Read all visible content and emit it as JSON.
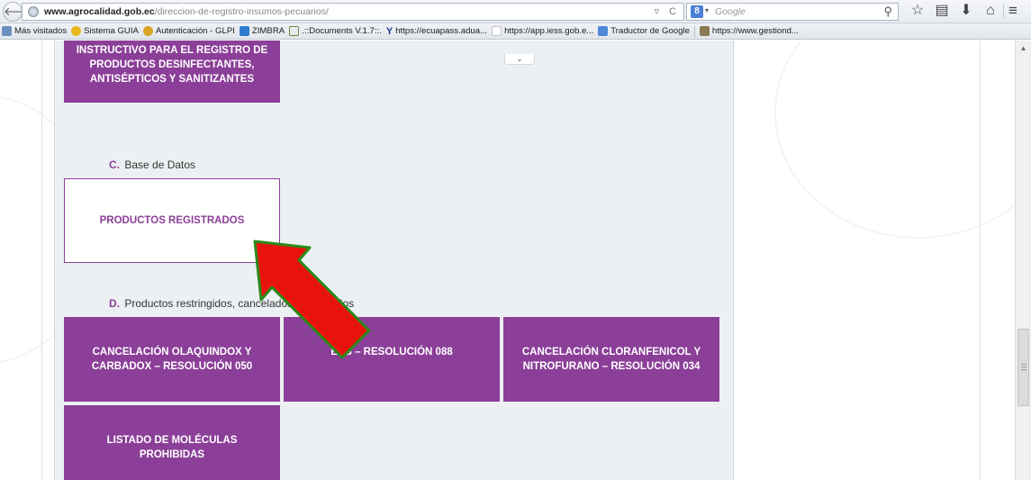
{
  "browser": {
    "url_domain": "www.agrocalidad.gob.ec",
    "url_path": "/direccion-de-registro-insumos-pecuarios/",
    "url_actions": "▿ C",
    "search_engine_letter": "8",
    "search_caret": "▾",
    "search_placeholder": "Google",
    "search_go": "⚲",
    "back_glyph": "🡐",
    "toolbar": [
      {
        "name": "bookmark-star-icon",
        "glyph": "☆"
      },
      {
        "name": "reading-list-icon",
        "glyph": "▤"
      },
      {
        "name": "download-icon",
        "glyph": "⬇"
      },
      {
        "name": "home-icon",
        "glyph": "⌂"
      }
    ],
    "menu_glyph": "≡"
  },
  "bookmarks": [
    {
      "label": "Más visitados",
      "icon": "folder"
    },
    {
      "label": "Sistema GUIA",
      "icon": "guia"
    },
    {
      "label": "Autenticación - GLPI",
      "icon": "glpi"
    },
    {
      "label": "ZIMBRA",
      "icon": "zimbra"
    },
    {
      "label": ".::Documents V.1.7::.",
      "icon": "doc"
    },
    {
      "label": "https://ecuapass.adua...",
      "icon": "v"
    },
    {
      "label": "https://app.iess.gob.e...",
      "icon": "blank"
    },
    {
      "label": "Traductor de Google",
      "icon": "tr"
    },
    {
      "label": "https://www.gestiond...",
      "icon": "gest"
    }
  ],
  "page": {
    "collapse_glyph": "⌄",
    "tile_instructivo": "INSTRUCTIVO PARA EL REGISTRO DE\nPRODUCTOS DESINFECTANTES,\nANTISÉPTICOS Y SANITIZANTES",
    "section_c": {
      "letter": "C.",
      "title": "Base de Datos"
    },
    "tile_registrados": "PRODUCTOS REGISTRADOS",
    "section_d": {
      "letter": "D.",
      "title": "Productos restringidos, cancelados y prohibidos"
    },
    "tiles_d": [
      "CANCELACIÓN OLAQUINDOX Y\nCARBADOX – RESOLUCIÓN 050",
      "EEB – RESOLUCIÓN 088",
      "CANCELACIÓN CLORANFENICOL Y\nNITROFURANO – RESOLUCIÓN 034",
      "LISTADO DE MOLÉCULAS PROHIBIDAS"
    ],
    "accent_color": "#8b3f98",
    "arrow_color": "#e8140c"
  }
}
